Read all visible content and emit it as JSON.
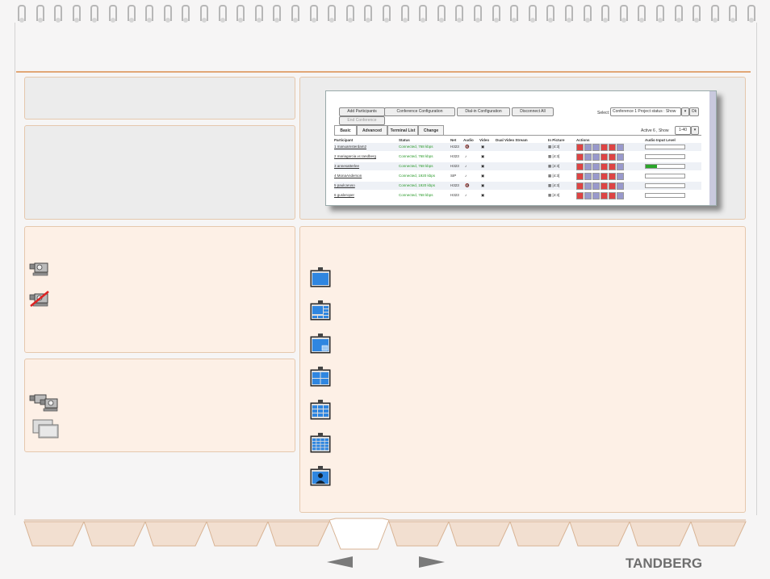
{
  "screenshot": {
    "buttons": {
      "add_participants": "Add Participants",
      "conference_configuration": "Conference Configuration",
      "dial_in_configuration": "Dial-in Configuration",
      "disconnect_all": "Disconnect All",
      "end_conference": "End Conference",
      "ok": "Ok"
    },
    "select_label": "Select:",
    "select_value": "Conference 1 Project status : Show",
    "active_label": "Active 6 , Show",
    "show_value": "1-40",
    "tabs": [
      "Basic",
      "Advanced",
      "Terminal List",
      "Change"
    ],
    "columns": [
      "Participant",
      "Status",
      "Net",
      "Audio",
      "Video",
      "Dual Video Stream",
      "In Picture",
      "Actions",
      "Audio Input Level"
    ],
    "rows": [
      {
        "participant": "1 manuamsterdam2",
        "status": "Connected, 768 kbps",
        "net": "H323",
        "layout": "[4:3]",
        "level": 0
      },
      {
        "participant": "2 mariagarcia.vc.tandberg",
        "status": "Connected, 768 kbps",
        "net": "H323",
        "layout": "[4:3]",
        "level": 0
      },
      {
        "participant": "3 annesatterlee",
        "status": "Connected, 768 kbps",
        "net": "H323",
        "layout": "[4:3]",
        "level": 0.3
      },
      {
        "participant": "4 MonaAnderson",
        "status": "Connected, 1920 kbps",
        "net": "SIP",
        "layout": "[4:3]",
        "level": 0
      },
      {
        "participant": "5 paulcaruso",
        "status": "Connected, 1920 kbps",
        "net": "H323",
        "layout": "[4:3]",
        "level": 0
      },
      {
        "participant": "6 gusleroper",
        "status": "Connected, 768 kbps",
        "net": "H323",
        "layout": "[4:3]",
        "level": 0
      }
    ]
  },
  "legend_icons": [
    "video-on-icon",
    "video-off-icon",
    "dual-video-icon",
    "multiple-windows-icon"
  ],
  "layout_icons": [
    "full-screen-layout-icon",
    "5-plus-1-layout-icon",
    "picture-in-picture-layout-icon",
    "4-split-layout-icon",
    "9-split-layout-icon",
    "16-split-layout-icon",
    "voice-switched-layout-icon"
  ],
  "footer": {
    "logo": "TANDBERG",
    "prev": "previous-page-arrow",
    "next": "next-page-arrow"
  },
  "colors": {
    "accent": "#e1a777",
    "peach_panel": "#fdf0e6",
    "grey_panel": "#ececec",
    "layout_blue": "#2f86e0"
  }
}
